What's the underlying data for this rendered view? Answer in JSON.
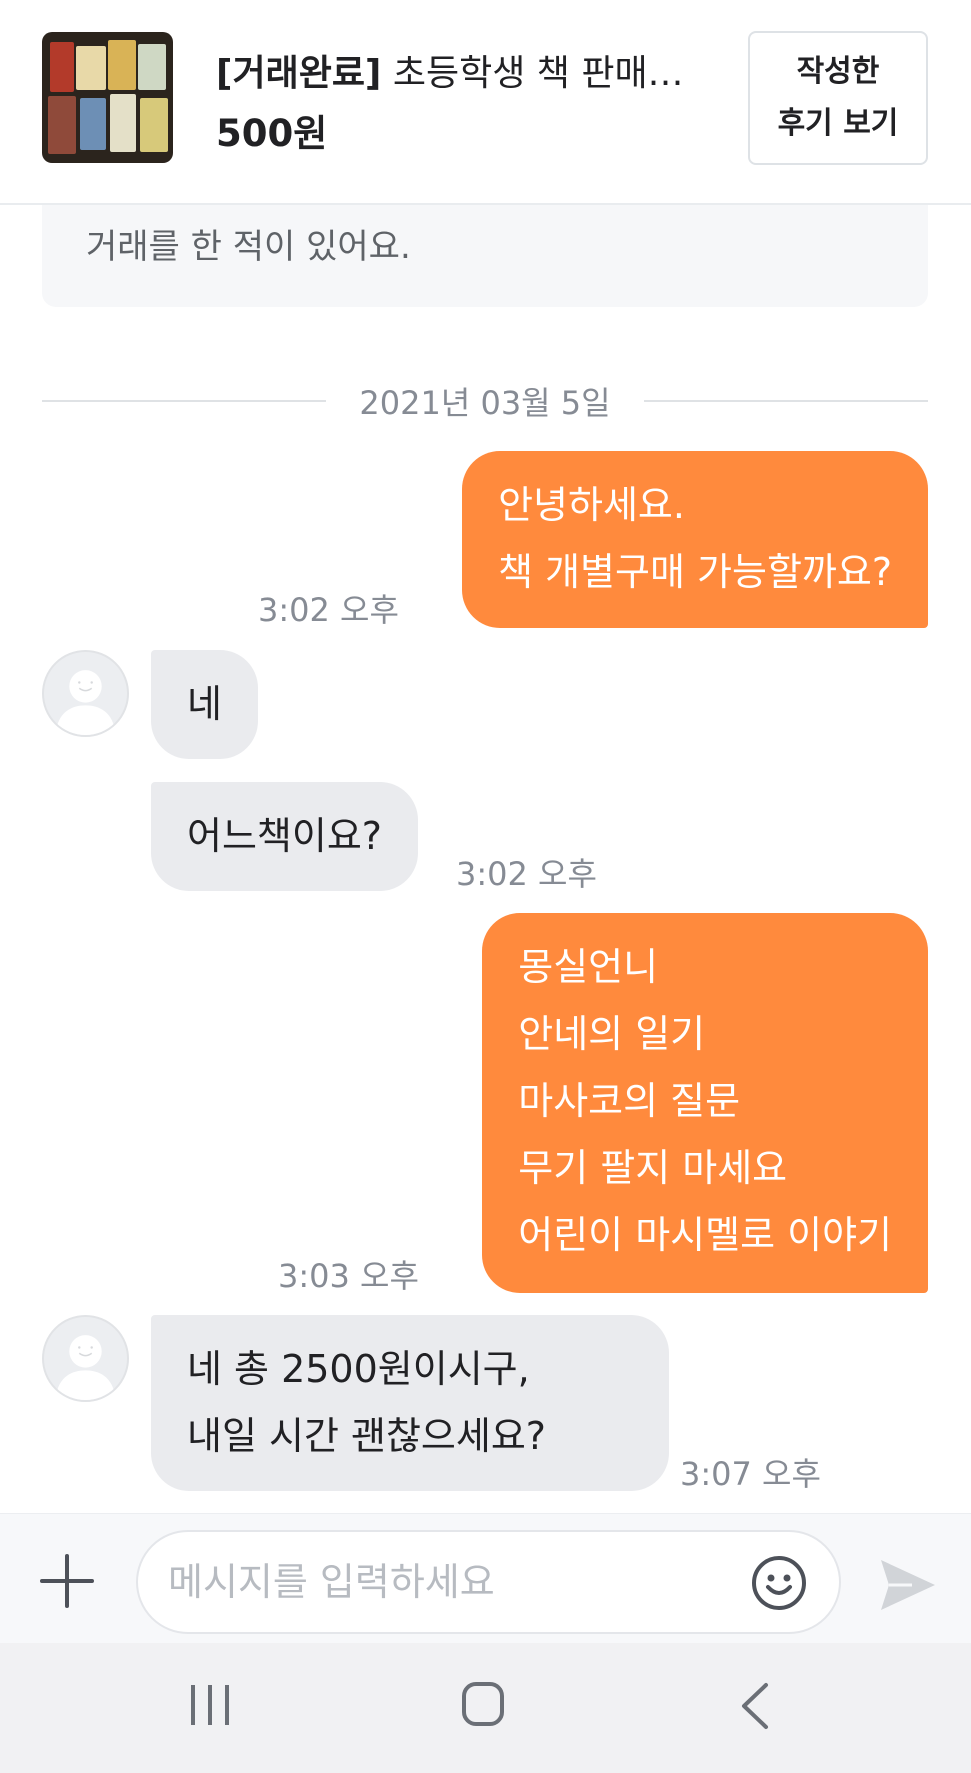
{
  "product": {
    "status": "[거래완료]",
    "title": " 초등학생 책 판매…",
    "price": "500원",
    "review_button": "작성한\n후기 보기"
  },
  "notice": "거래를 한 적이 있어요.",
  "date_divider": "2021년 03월 5일",
  "messages": [
    {
      "side": "out",
      "lines": [
        "안녕하세요.",
        "책 개별구매 가능할까요?"
      ],
      "time": "3:02 오후"
    },
    {
      "side": "in",
      "lines": [
        "네"
      ],
      "time": ""
    },
    {
      "side": "in",
      "lines": [
        "어느책이요?"
      ],
      "time": "3:02 오후"
    },
    {
      "side": "out",
      "lines": [
        "몽실언니",
        "안네의 일기",
        "마사코의 질문",
        "무기 팔지 마세요",
        "어린이 마시멜로 이야기"
      ],
      "time": "3:03 오후"
    },
    {
      "side": "in",
      "lines": [
        "네 총 2500원이시구,",
        "내일 시간 괜찮으세요?"
      ],
      "time": "3:07 오후"
    }
  ],
  "composer": {
    "placeholder": "메시지를 입력하세요",
    "value": ""
  },
  "colors": {
    "outgoing_bubble": "#ff8a3d",
    "incoming_bubble": "#eaebee",
    "meta_text": "#868b94"
  },
  "icons": {
    "add": "plus-icon",
    "emoji": "smile-icon",
    "send": "send-icon",
    "nav": [
      "recents-icon",
      "home-icon",
      "back-icon"
    ]
  }
}
